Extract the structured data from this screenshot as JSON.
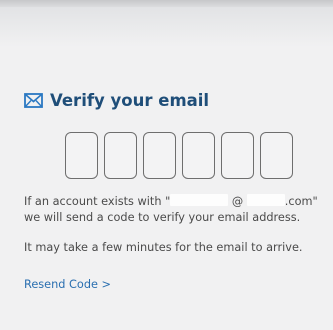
{
  "header": {
    "icon": "mail-icon",
    "title": "Verify your email",
    "accent_color": "#1f4e79"
  },
  "code_input": {
    "digits": [
      "",
      "",
      "",
      "",
      "",
      ""
    ]
  },
  "message": {
    "line1_prefix": "If an account exists with \"",
    "email_at": "@",
    "line1_suffix": ".com\"",
    "line2": "we will send a code to verify your email address.",
    "note": "It may take a few minutes for the email to arrive."
  },
  "resend": {
    "label": "Resend Code >",
    "color": "#2a6fb0"
  }
}
